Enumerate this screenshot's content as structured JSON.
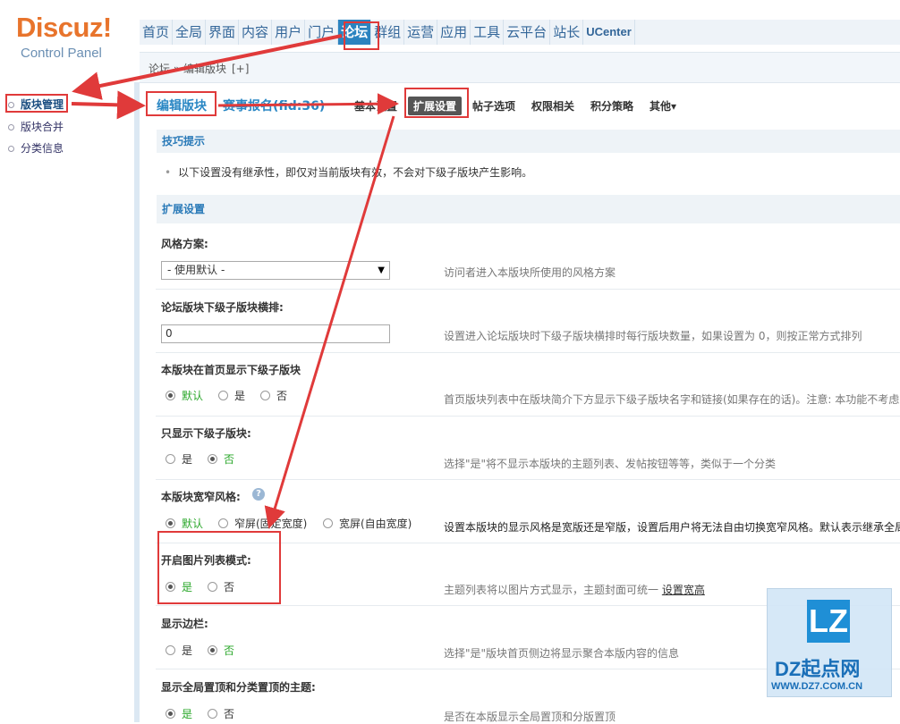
{
  "logo": {
    "brand": "Discuz!",
    "sub": "Control Panel"
  },
  "topnav": [
    "首页",
    "全局",
    "界面",
    "内容",
    "用户",
    "门户",
    "论坛",
    "群组",
    "运营",
    "应用",
    "工具",
    "云平台",
    "站长",
    "UCenter"
  ],
  "topnav_active": "论坛",
  "breadcrumb": {
    "text": "论坛 » 编辑版块",
    "plus": "[+]"
  },
  "sidebar": [
    {
      "label": "版块管理",
      "active": true
    },
    {
      "label": "版块合并",
      "active": false
    },
    {
      "label": "分类信息",
      "active": false
    }
  ],
  "tabs": {
    "title": "编辑版块",
    "forum": "赛事报名(fid:36)",
    "items": [
      "基本设置",
      "扩展设置",
      "帖子选项",
      "权限相关",
      "积分策略",
      "其他▾"
    ],
    "active": "扩展设置"
  },
  "tips": {
    "heading": "技巧提示",
    "text": "以下设置没有继承性，即仅对当前版块有效，不会对下级子版块产生影响。",
    "bullet": "•"
  },
  "section_heading": "扩展设置",
  "settings": {
    "style": {
      "label": "风格方案:",
      "value": "- 使用默认 -",
      "desc": "访问者进入本版块所使用的风格方案"
    },
    "subforum_cols": {
      "label": "论坛版块下级子版块横排:",
      "value": "0",
      "desc": "设置进入论坛版块时下级子版块横排时每行版块数量，如果设置为 0，则按正常方式排列"
    },
    "show_sub_home": {
      "label": "本版块在首页显示下级子版块",
      "options": [
        "默认",
        "是",
        "否"
      ],
      "desc": "首页版块列表中在版块简介下方显示下级子版块名字和链接(如果存在的话)。注意: 本功能不考虑"
    },
    "only_sub": {
      "label": "只显示下级子版块:",
      "options": [
        "是",
        "否"
      ],
      "desc": "选择\"是\"将不显示本版块的主题列表、发帖按钮等等，类似于一个分类"
    },
    "width_style": {
      "label": "本版块宽窄风格:",
      "help": "?",
      "options": [
        "默认",
        "窄屏(固定宽度)",
        "宽屏(自由宽度)"
      ],
      "desc": "设置本版块的显示风格是宽版还是窄版，设置后用户将无法自由切换宽窄风格。默认表示继承全局"
    },
    "image_list": {
      "label": "开启图片列表模式:",
      "options": [
        "是",
        "否"
      ],
      "desc": "主题列表将以图片方式显示，主题封面可统一",
      "link": "设置宽高"
    },
    "sidebar_show": {
      "label": "显示边栏:",
      "options": [
        "是",
        "否"
      ],
      "desc": "选择\"是\"版块首页侧边将显示聚合本版内容的信息"
    },
    "global_top": {
      "label": "显示全局置顶和分类置顶的主题:",
      "options": [
        "是",
        "否"
      ],
      "desc": "是否在本版显示全局置顶和分版置顶"
    }
  },
  "watermark": {
    "logo": "LZ",
    "name": "DZ起点网",
    "url": "WWW.DZ7.COM.CN"
  },
  "colors": {
    "accent": "#2a87c4",
    "nav_active": "#2b83c0",
    "annotation": "#e03a3a",
    "selected": "#2aa72a"
  }
}
